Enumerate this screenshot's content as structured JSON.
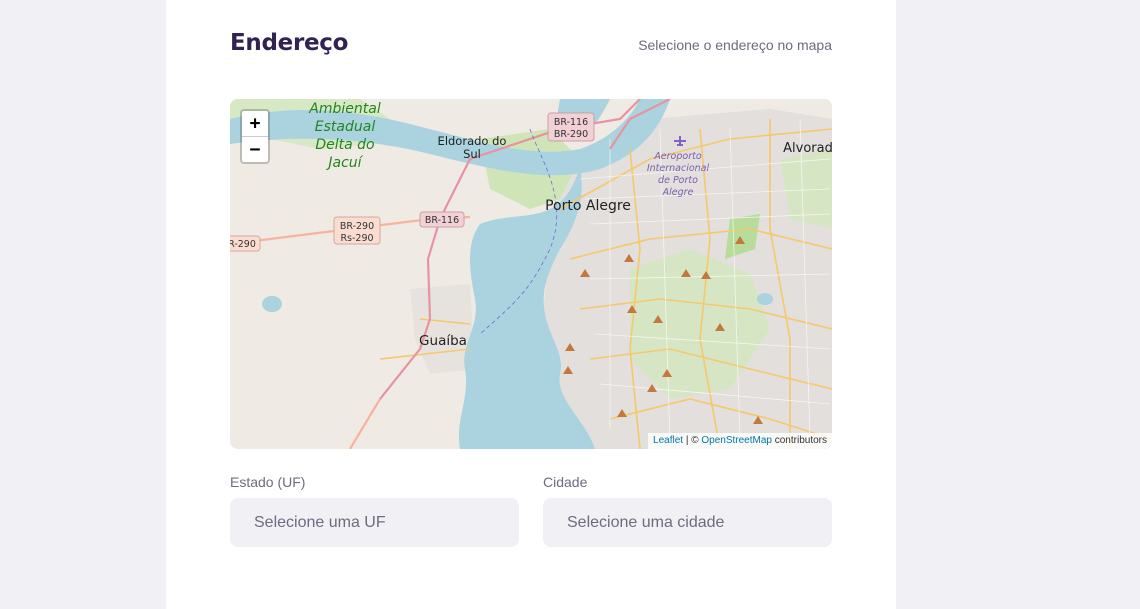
{
  "section": {
    "title": "Endereço",
    "subtitle": "Selecione o endereço no mapa"
  },
  "map": {
    "zoom_in": "+",
    "zoom_out": "−",
    "labels": {
      "ambiental_1": "Ambiental",
      "ambiental_2": "Estadual",
      "ambiental_3": "Delta do",
      "ambiental_4": "Jacuí",
      "eldorado_1": "Eldorado do",
      "eldorado_2": "Sul",
      "porto_alegre": "Porto Alegre",
      "alvorada": "Alvorad",
      "guaiba": "Guaíba",
      "airport_1": "Aeroporto",
      "airport_2": "Internacional",
      "airport_3": "de Porto",
      "airport_4": "Alegre",
      "shield_br116_top_1": "BR-116",
      "shield_br116_top_2": "BR-290",
      "shield_br116_mid": "BR-116",
      "shield_br290_1": "BR-290",
      "shield_br290_2": "Rs-290",
      "shield_br290_left": "R-290"
    },
    "attribution": {
      "leaflet": "Leaflet",
      "separator": " | © ",
      "osm": "OpenStreetMap",
      "suffix": " contributors"
    },
    "colors": {
      "water": "#aad3df",
      "land": "#efeae3",
      "urban": "#e0dfdf",
      "park": "#cde6b4",
      "primary_road": "#e892a2",
      "trunk_road": "#f9b29c",
      "secondary_road": "#f7c86a"
    }
  },
  "form": {
    "state_label": "Estado (UF)",
    "state_placeholder": "Selecione uma UF",
    "city_label": "Cidade",
    "city_placeholder": "Selecione uma cidade"
  }
}
